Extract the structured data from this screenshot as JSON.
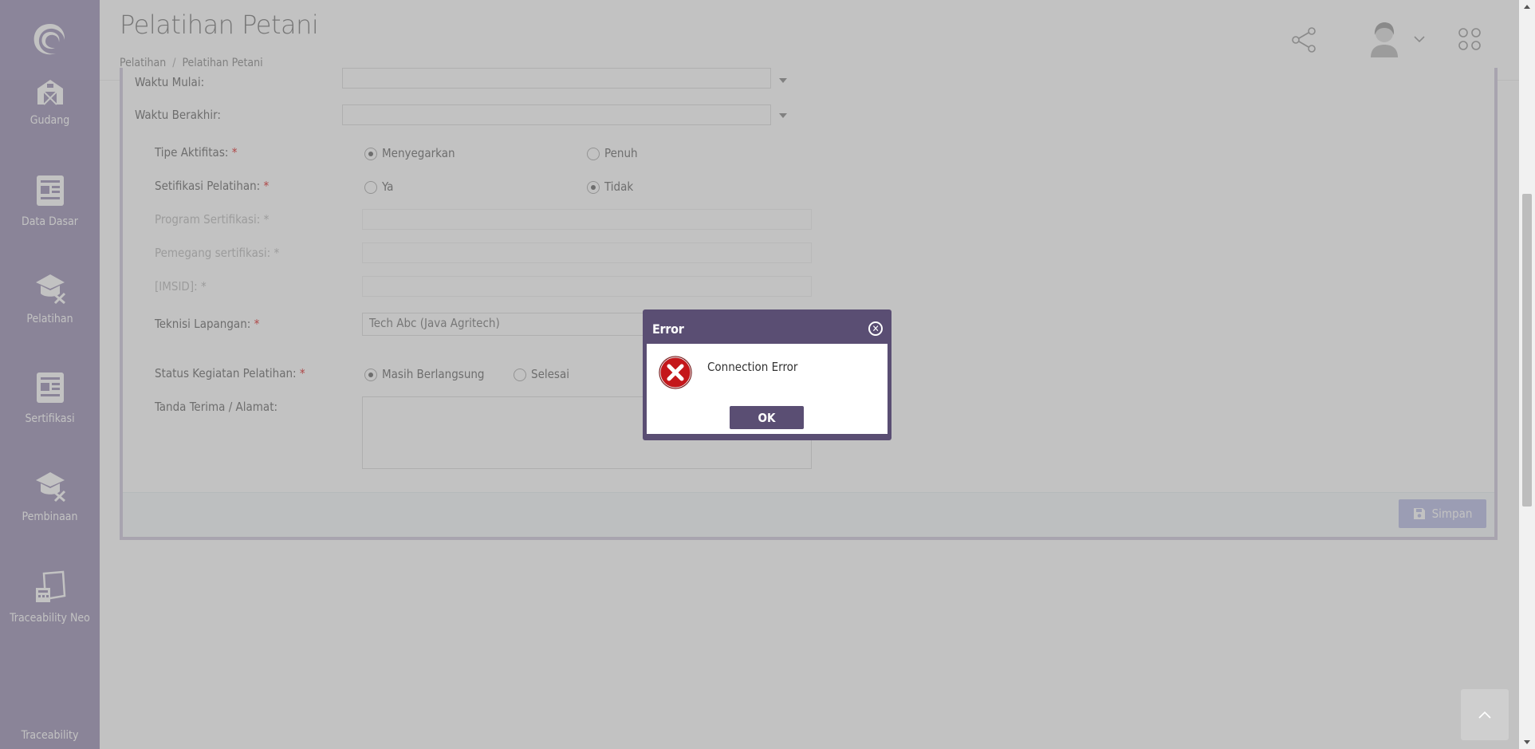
{
  "header": {
    "title": "Pelatihan Petani",
    "breadcrumb": [
      "Pelatihan",
      "Pelatihan Petani"
    ]
  },
  "sidebar": {
    "items": [
      {
        "label": "Gudang",
        "icon": "warehouse-icon"
      },
      {
        "label": "Data Dasar",
        "icon": "document-icon"
      },
      {
        "label": "Pelatihan",
        "icon": "farmer-tools-icon"
      },
      {
        "label": "Sertifikasi",
        "icon": "document-icon"
      },
      {
        "label": "Pembinaan",
        "icon": "farmer-tools-icon"
      },
      {
        "label": "Traceability Neo",
        "icon": "sack-calculator-icon"
      },
      {
        "label": "Traceability"
      }
    ]
  },
  "form": {
    "waktu_mulai_label": "Waktu Mulai:",
    "waktu_berakhir_label": "Waktu Berakhir:",
    "tipe_aktifitas_label": "Tipe Aktifitas:",
    "tipe_aktifitas_options": [
      "Menyegarkan",
      "Penuh"
    ],
    "sertifikasi_label": "Setifikasi Pelatihan:",
    "sertifikasi_options": [
      "Ya",
      "Tidak"
    ],
    "program_sertifikasi_label": "Program Sertifikasi:",
    "pemegang_sertifikasi_label": "Pemegang sertifikasi:",
    "imsid_label": "[IMSID]:",
    "teknisi_label": "Teknisi Lapangan:",
    "teknisi_value": "Tech Abc (Java Agritech)",
    "status_label": "Status Kegiatan Pelatihan:",
    "status_options": [
      "Masih Berlangsung",
      "Selesai"
    ],
    "tanda_terima_label": "Tanda Terima / Alamat:",
    "required_mark": "*",
    "save_label": "Simpan"
  },
  "dialog": {
    "title": "Error",
    "message": "Connection Error",
    "ok_label": "OK",
    "close_symbol": "✕"
  },
  "colors": {
    "sidebar": "#9a8fb3",
    "dialog": "#5a4e73",
    "save_button": "#b9bce6"
  }
}
